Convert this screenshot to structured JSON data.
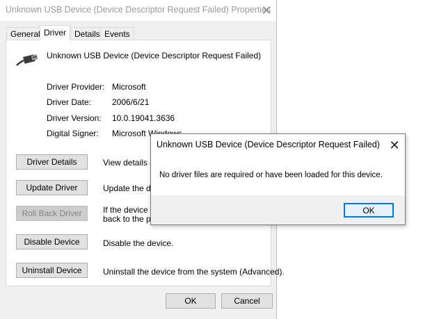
{
  "main_window": {
    "title": "Unknown USB Device (Device Descriptor Request Failed) Properties",
    "close_glyph": "✕",
    "tabs": [
      {
        "label": "General"
      },
      {
        "label": "Driver"
      },
      {
        "label": "Details"
      },
      {
        "label": "Events"
      }
    ],
    "active_tab": "Driver",
    "device_icon": "usb-plug-icon",
    "device_name": "Unknown USB Device (Device Descriptor Request Failed)",
    "info": {
      "provider_label": "Driver Provider:",
      "provider_value": "Microsoft",
      "date_label": "Driver Date:",
      "date_value": "2006/6/21",
      "version_label": "Driver Version:",
      "version_value": "10.0.19041.3636",
      "signer_label": "Digital Signer:",
      "signer_value": "Microsoft Windows"
    },
    "actions": {
      "driver_details_label": "Driver Details",
      "driver_details_desc": "View details ab",
      "update_driver_label": "Update Driver",
      "update_driver_desc": "Update the dri",
      "roll_back_label": "Roll Back Driver",
      "roll_back_desc_line1": "If the device fa",
      "roll_back_desc_line2": "back to the pre",
      "disable_label": "Disable Device",
      "disable_desc": "Disable the device.",
      "uninstall_label": "Uninstall Device",
      "uninstall_desc": "Uninstall the device from the system (Advanced)."
    },
    "footer": {
      "ok_label": "OK",
      "cancel_label": "Cancel"
    }
  },
  "dialog": {
    "title": "Unknown USB Device (Device Descriptor Request Failed)",
    "close_glyph": "✕",
    "message": "No driver files are required or have been loaded for this device.",
    "ok_label": "OK"
  },
  "colors": {
    "window_bg": "#f0f0f0",
    "panel_bg": "#ffffff",
    "focus_blue": "#0078d7",
    "button_bg": "#e1e1e1"
  }
}
